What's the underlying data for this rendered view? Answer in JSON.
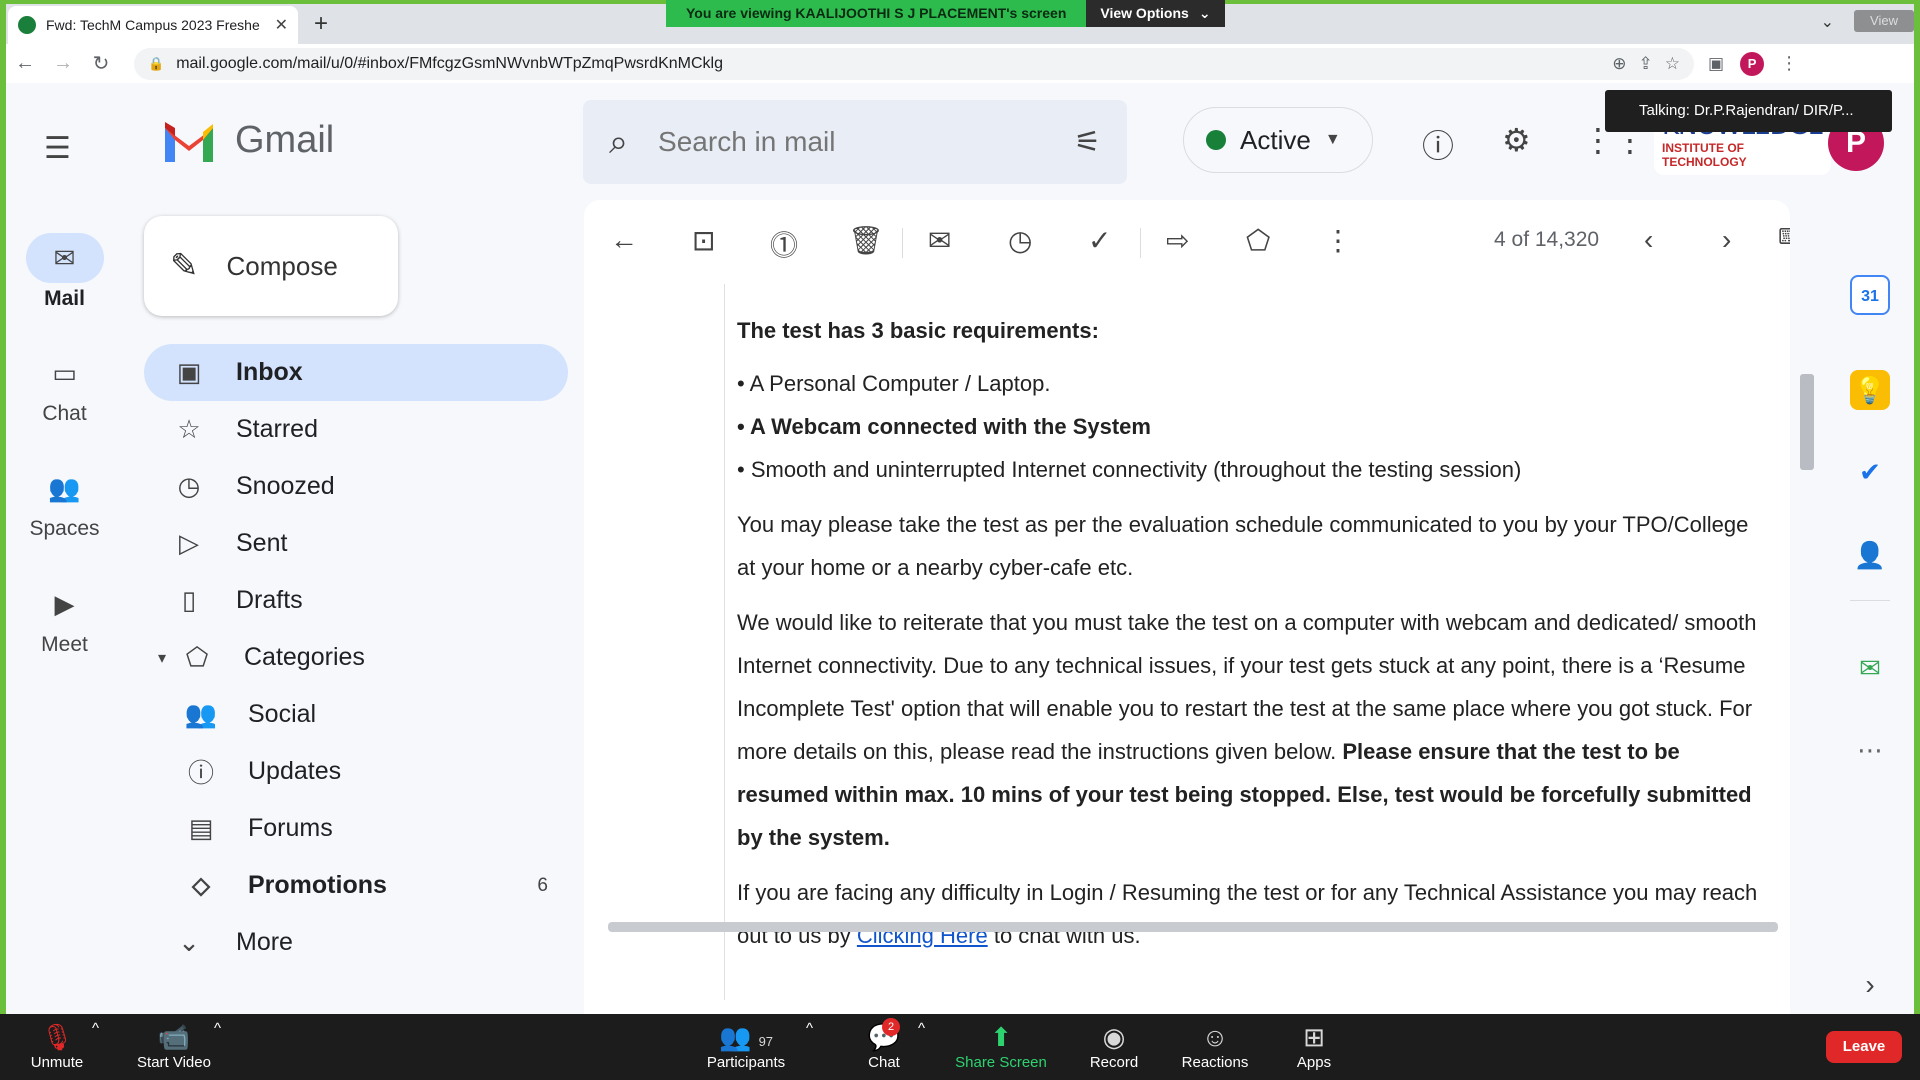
{
  "zoom": {
    "share_banner": "You are viewing KAALIJOOTHI S J PLACEMENT's screen",
    "view_options": "View Options",
    "view_label": "View",
    "talking": "Talking:  Dr.P.Rajendran/  DIR/P...",
    "bottom": {
      "unmute": "Unmute",
      "start_video": "Start Video",
      "participants": "Participants",
      "participants_count": "97",
      "chat": "Chat",
      "chat_badge": "2",
      "share_screen": "Share Screen",
      "record": "Record",
      "reactions": "Reactions",
      "apps": "Apps",
      "leave": "Leave"
    }
  },
  "browser": {
    "tab_title": "Fwd: TechM Campus 2023 Freshe",
    "url": "mail.google.com/mail/u/0/#inbox/FMfcgzGsmNWvnbWTpZmqPwsrdKnMCklg",
    "profile_initial": "P"
  },
  "gmail": {
    "brand": "Gmail",
    "rail": [
      {
        "label": "Mail",
        "icon": "mail-icon"
      },
      {
        "label": "Chat",
        "icon": "chat-icon"
      },
      {
        "label": "Spaces",
        "icon": "spaces-icon"
      },
      {
        "label": "Meet",
        "icon": "meet-icon"
      }
    ],
    "compose": "Compose",
    "nav": {
      "inbox": "Inbox",
      "starred": "Starred",
      "snoozed": "Snoozed",
      "sent": "Sent",
      "drafts": "Drafts",
      "categories": "Categories",
      "social": "Social",
      "updates": "Updates",
      "forums": "Forums",
      "promotions": "Promotions",
      "promotions_count": "6",
      "more": "More"
    },
    "search_placeholder": "Search in mail",
    "status": "Active",
    "org_logo_line1": "KNOWLEDGE",
    "org_logo_line2": "INSTITUTE OF TECHNOLOGY",
    "avatar_initial": "P",
    "pager": "4 of 14,320",
    "calendar_day": "31"
  },
  "email": {
    "heading": "The test has 3 basic requirements:",
    "bullet1": "• A Personal Computer / Laptop.",
    "bullet2": "• A Webcam connected with the System",
    "bullet3": "• Smooth and uninterrupted Internet connectivity (throughout the testing session)",
    "para1": "You may please take the test as per the evaluation schedule communicated to you by your TPO/College at your home or a nearby cyber-cafe etc.",
    "para2": "We would like to reiterate that you must take the test on a computer with webcam and dedicated/ smooth Internet connectivity. Due to any technical issues, if your test gets stuck at any point, there is a ‘Resume Incomplete Test' option that will enable you to restart the test at the same place where you got stuck. For more details on this, please read the instructions given below.",
    "para2_bold": "Please ensure that the test to be resumed within max. 10 mins of your test being stopped. Else, test would be forcefully submitted by the system.",
    "para3_start": "If you are facing any difficulty in Login / Resuming the test or for any Technical Assistance you may reach out to us by",
    "para3_link": "Clicking Here",
    "para3_end": "to chat with us."
  }
}
